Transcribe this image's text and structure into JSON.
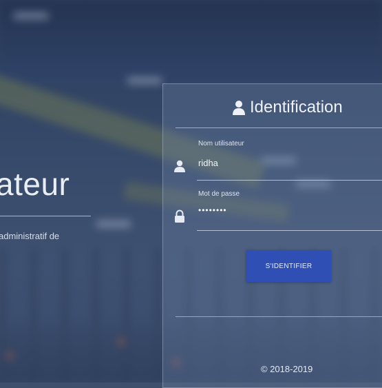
{
  "hero": {
    "title": "ateur",
    "subtitle": "administratif de"
  },
  "login": {
    "title": "Identification",
    "username": {
      "label": "Nom utilisateur",
      "value": "ridha"
    },
    "password": {
      "label": "Mot de passe",
      "value": "••••••••"
    },
    "submit_label": "S'IDENTIFIER",
    "copyright": "© 2018-2019"
  },
  "colors": {
    "button": "#2f4fb4",
    "panel_text": "#eef2f8"
  },
  "icons": {
    "title": "user-icon",
    "username": "user-icon",
    "password": "lock-icon"
  }
}
